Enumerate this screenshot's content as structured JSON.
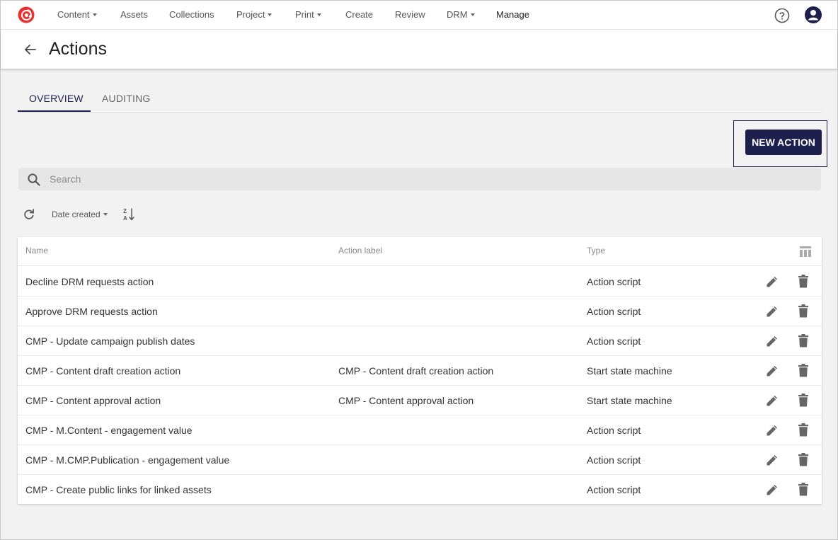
{
  "nav": {
    "items": [
      {
        "label": "Content",
        "dropdown": true
      },
      {
        "label": "Assets",
        "dropdown": false
      },
      {
        "label": "Collections",
        "dropdown": false
      },
      {
        "label": "Project",
        "dropdown": true
      },
      {
        "label": "Print",
        "dropdown": true
      },
      {
        "label": "Create",
        "dropdown": false
      },
      {
        "label": "Review",
        "dropdown": false
      },
      {
        "label": "DRM",
        "dropdown": true
      },
      {
        "label": "Manage",
        "dropdown": false,
        "active": true
      }
    ],
    "icons": {
      "logo": "brand-logo-icon",
      "help": "help-circle-icon",
      "user": "user-avatar-icon"
    }
  },
  "header": {
    "title": "Actions"
  },
  "tabs": [
    {
      "label": "OVERVIEW",
      "active": true
    },
    {
      "label": "AUDITING",
      "active": false
    }
  ],
  "toolbar": {
    "new_action_label": "NEW ACTION"
  },
  "search": {
    "placeholder": "Search",
    "value": ""
  },
  "sort": {
    "label": "Date created"
  },
  "table": {
    "columns": [
      "Name",
      "Action label",
      "Type"
    ],
    "rows": [
      {
        "name": "Decline DRM requests action",
        "action_label": "",
        "type": "Action script"
      },
      {
        "name": "Approve DRM requests action",
        "action_label": "",
        "type": "Action script"
      },
      {
        "name": "CMP - Update campaign publish dates",
        "action_label": "",
        "type": "Action script"
      },
      {
        "name": "CMP - Content draft creation action",
        "action_label": "CMP - Content draft creation action",
        "type": "Start state machine"
      },
      {
        "name": "CMP - Content approval action",
        "action_label": "CMP - Content approval action",
        "type": "Start state machine"
      },
      {
        "name": "CMP - M.Content - engagement value",
        "action_label": "",
        "type": "Action script"
      },
      {
        "name": "CMP - M.CMP.Publication - engagement value",
        "action_label": "",
        "type": "Action script"
      },
      {
        "name": "CMP - Create public links for linked assets",
        "action_label": "",
        "type": "Action script"
      }
    ]
  },
  "colors": {
    "accent": "#1d1f4e",
    "brand": "#e8312f",
    "background": "#f2f2f2"
  }
}
